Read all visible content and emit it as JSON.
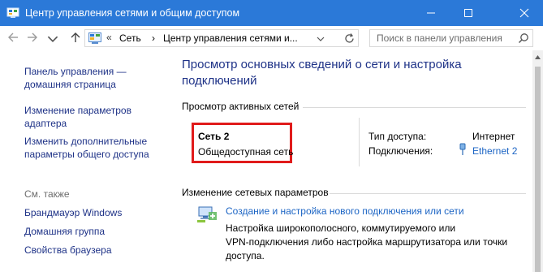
{
  "window": {
    "title": "Центр управления сетями и общим доступом"
  },
  "address_bar": {
    "overflow": "«",
    "breadcrumbs": [
      "Сеть",
      "Центр управления сетями и..."
    ],
    "separator": "›",
    "search_placeholder": "Поиск в панели управления"
  },
  "sidebar": {
    "links": [
      {
        "label_line1": "Панель управления —",
        "label_line2": "домашняя страница"
      },
      {
        "label_line1": "Изменение параметров",
        "label_line2": "адаптера"
      },
      {
        "label_line1": "Изменить дополнительные",
        "label_line2": "параметры общего доступа"
      }
    ],
    "see_also_title": "См. также",
    "see_also": [
      "Брандмауэр Windows",
      "Домашняя группа",
      "Свойства браузера"
    ]
  },
  "main": {
    "heading_line1": "Просмотр основных сведений о сети и настройка",
    "heading_line2": "подключений",
    "active_networks_title": "Просмотр активных сетей",
    "network": {
      "name": "Сеть  2",
      "type": "Общедоступная сеть",
      "access_type_label": "Тип доступа:",
      "access_type_value": "Интернет",
      "connections_label": "Подключения:",
      "connections_value": "Ethernet 2"
    },
    "change_settings_title": "Изменение сетевых параметров",
    "tasks": [
      {
        "title": "Создание и настройка нового подключения или сети",
        "desc_line1": "Настройка широкополосного, коммутируемого или",
        "desc_line2": "VPN-подключения либо настройка маршрутизатора или точки",
        "desc_line3": "доступа."
      }
    ]
  },
  "colors": {
    "titlebar": "#2b79d8",
    "link": "#1b64c4",
    "heading": "#1e3287",
    "highlight_box": "#e01b1b"
  },
  "icons": [
    "control-panel-icon",
    "minimize-icon",
    "maximize-icon",
    "close-icon",
    "back-arrow-icon",
    "forward-arrow-icon",
    "chevron-down-icon",
    "up-arrow-icon",
    "refresh-icon",
    "search-icon",
    "ethernet-icon",
    "new-connection-icon"
  ]
}
